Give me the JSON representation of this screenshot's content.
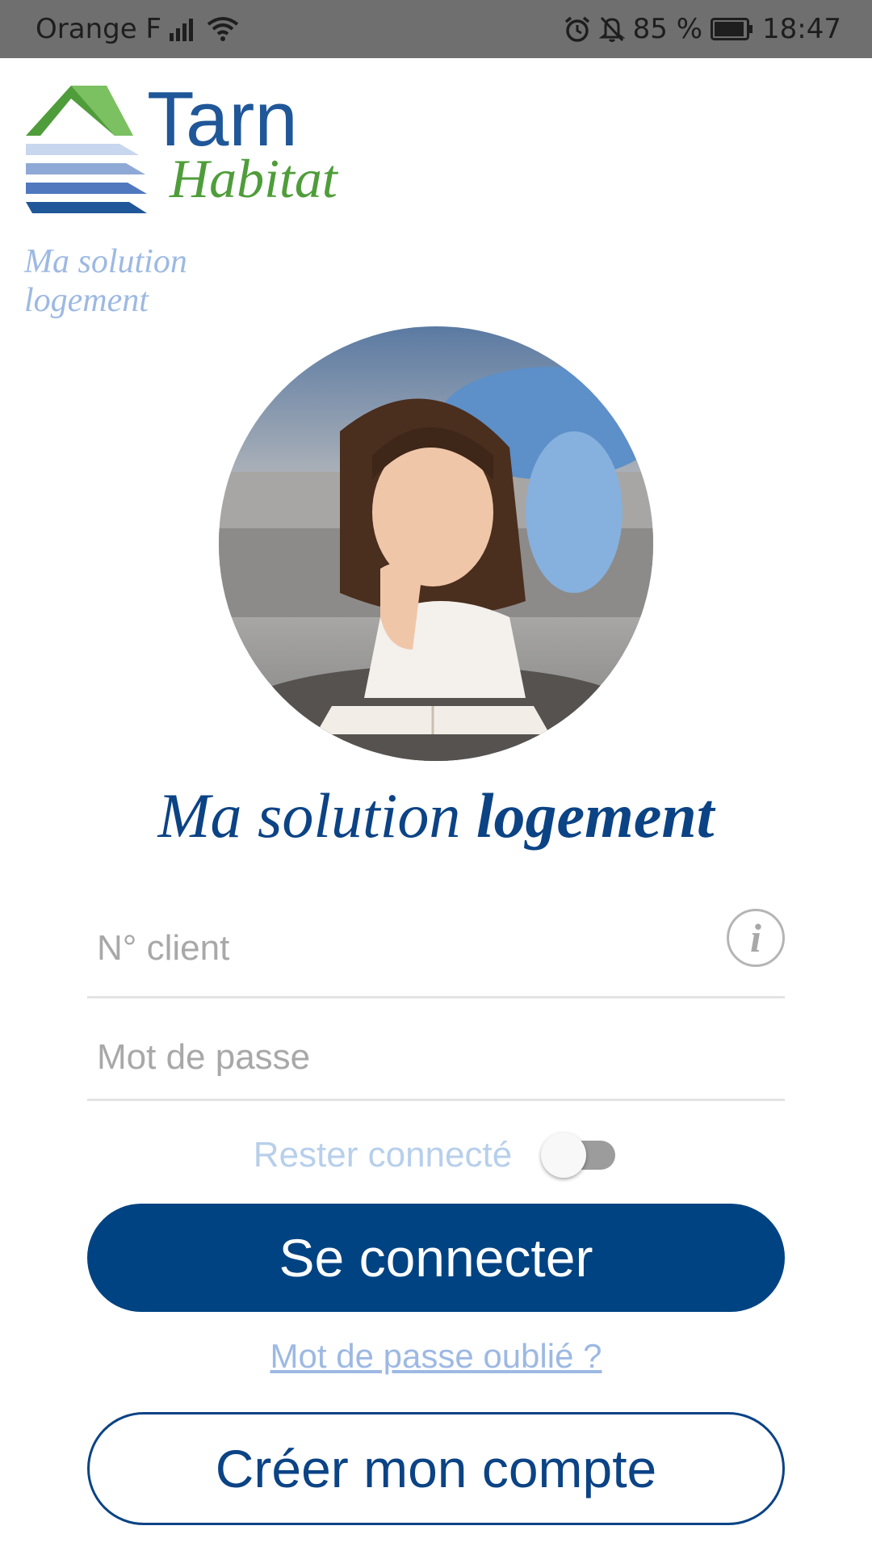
{
  "status_bar": {
    "carrier": "Orange F",
    "battery": "85 %",
    "time": "18:47",
    "icons": [
      "signal-icon",
      "wifi-icon",
      "alarm-icon",
      "notifications-off-icon",
      "battery-icon"
    ]
  },
  "logo": {
    "word1": "Tarn",
    "word2": "Habitat",
    "tagline": "Ma solution logement",
    "colors": {
      "blue": "#1f5798",
      "green": "#4f9d3a",
      "light_blue": "#9db9e3"
    }
  },
  "hero": {
    "icon": "hero-photo"
  },
  "title": {
    "regular": "Ma solution ",
    "bold": "logement"
  },
  "form": {
    "client_placeholder": "N° client",
    "password_placeholder": "Mot de passe",
    "info_label": "i",
    "remember_label": "Rester connecté",
    "remember_on": false
  },
  "buttons": {
    "login": "Se connecter",
    "forgot": "Mot de passe oublié ?",
    "create": "Créer mon compte"
  },
  "colors": {
    "primary": "#004382",
    "link": "#9db9e3",
    "status_bar": "#6f6f6f"
  }
}
